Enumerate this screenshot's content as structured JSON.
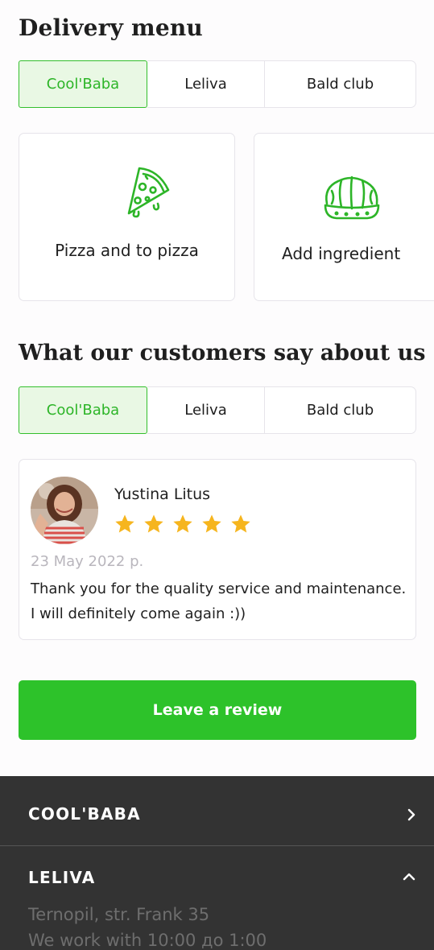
{
  "delivery": {
    "title": "Delivery menu",
    "tabs": [
      {
        "label": "Cool'Baba",
        "active": true
      },
      {
        "label": "Leliva",
        "active": false
      },
      {
        "label": "Bald club",
        "active": false
      }
    ],
    "categories": [
      {
        "label": "Pizza and to pizza",
        "icon": "pizza-slice-icon"
      },
      {
        "label": "Add ingredient",
        "icon": "pie-dough-icon"
      }
    ]
  },
  "reviews": {
    "title": "What our customers say about us",
    "tabs": [
      {
        "label": "Cool'Baba",
        "active": true
      },
      {
        "label": "Leliva",
        "active": false
      },
      {
        "label": "Bald club",
        "active": false
      }
    ],
    "items": [
      {
        "name": "Yustina Litus",
        "rating": 5,
        "max_rating": 5,
        "date": "23 May 2022 p.",
        "text": "Thank you for the quality service and maintenance. I will definitely come again :))"
      }
    ],
    "cta_label": "Leave a review"
  },
  "footer": {
    "sections": [
      {
        "name": "COOL'BABA",
        "expanded": false,
        "icon": "chevron-right-icon"
      },
      {
        "name": "LELIVA",
        "expanded": true,
        "icon": "chevron-up-icon",
        "address": "Ternopil, str. Frank 35",
        "hours": "We work with 10:00 до 1:00"
      }
    ]
  },
  "colors": {
    "accent": "#2dc22a",
    "accent_light": "#e9f8e4",
    "star": "#f6b51e",
    "footer_bg": "#333333",
    "border": "#e6e4ea"
  }
}
